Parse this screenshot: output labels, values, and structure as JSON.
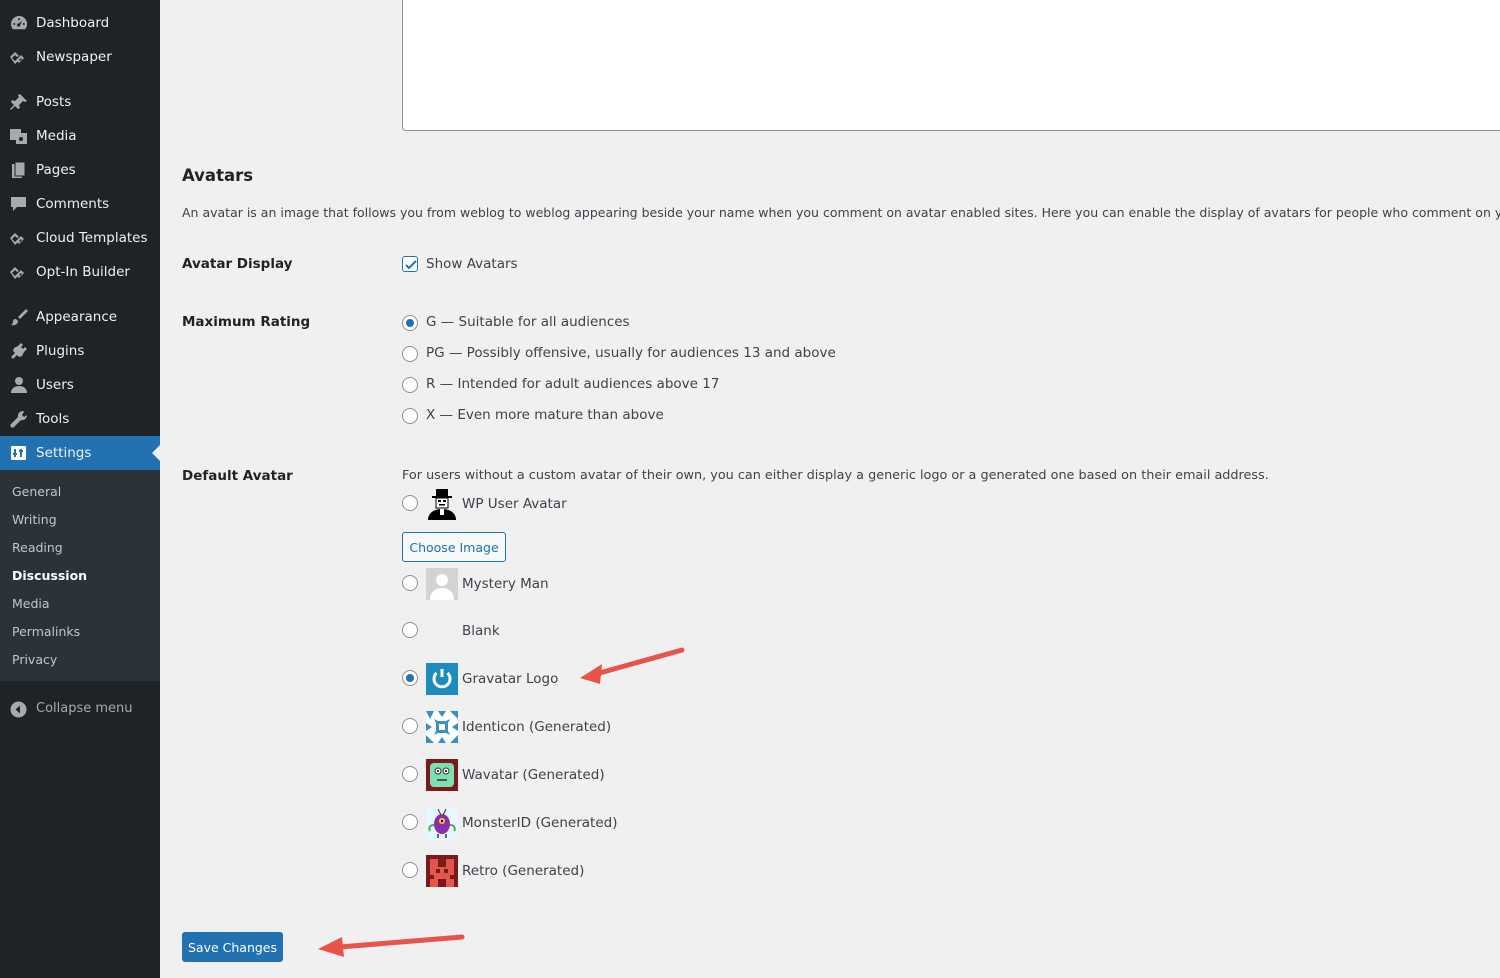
{
  "sidebar": {
    "items": [
      {
        "label": "Dashboard",
        "icon": "dashboard-icon"
      },
      {
        "label": "Newspaper",
        "icon": "newspaper-icon"
      },
      {
        "label": "Posts",
        "icon": "pin-icon"
      },
      {
        "label": "Media",
        "icon": "media-icon"
      },
      {
        "label": "Pages",
        "icon": "pages-icon"
      },
      {
        "label": "Comments",
        "icon": "comments-icon"
      },
      {
        "label": "Cloud Templates",
        "icon": "cloud-templates-icon"
      },
      {
        "label": "Opt-In Builder",
        "icon": "optin-icon"
      },
      {
        "label": "Appearance",
        "icon": "brush-icon"
      },
      {
        "label": "Plugins",
        "icon": "plug-icon"
      },
      {
        "label": "Users",
        "icon": "user-icon"
      },
      {
        "label": "Tools",
        "icon": "wrench-icon"
      },
      {
        "label": "Settings",
        "icon": "settings-icon"
      }
    ],
    "submenu": [
      "General",
      "Writing",
      "Reading",
      "Discussion",
      "Media",
      "Permalinks",
      "Privacy"
    ],
    "current_submenu": "Discussion",
    "collapse_label": "Collapse menu"
  },
  "avatars": {
    "title": "Avatars",
    "description": "An avatar is an image that follows you from weblog to weblog appearing beside your name when you comment on avatar enabled sites. Here you can enable the display of avatars for people who comment on your site.",
    "display": {
      "label": "Avatar Display",
      "checkbox_label": "Show Avatars",
      "checked": true
    },
    "rating": {
      "label": "Maximum Rating",
      "options": [
        {
          "label": "G — Suitable for all audiences",
          "checked": true
        },
        {
          "label": "PG — Possibly offensive, usually for audiences 13 and above",
          "checked": false
        },
        {
          "label": "R — Intended for adult audiences above 17",
          "checked": false
        },
        {
          "label": "X — Even more mature than above",
          "checked": false
        }
      ]
    },
    "default_avatar": {
      "label": "Default Avatar",
      "description": "For users without a custom avatar of their own, you can either display a generic logo or a generated one based on their email address.",
      "choose_image_label": "Choose Image",
      "options": [
        {
          "label": "WP User Avatar",
          "checked": false
        },
        {
          "label": "Mystery Man",
          "checked": false
        },
        {
          "label": "Blank",
          "checked": false
        },
        {
          "label": "Gravatar Logo",
          "checked": true
        },
        {
          "label": "Identicon (Generated)",
          "checked": false
        },
        {
          "label": "Wavatar (Generated)",
          "checked": false
        },
        {
          "label": "MonsterID (Generated)",
          "checked": false
        },
        {
          "label": "Retro (Generated)",
          "checked": false
        }
      ]
    }
  },
  "save_label": "Save Changes",
  "colors": {
    "sidebar_bg": "#1d2327",
    "submenu_bg": "#2c3338",
    "accent": "#2271b1",
    "page_bg": "#f0f0f1",
    "annotation_arrow": "#e8534a"
  }
}
